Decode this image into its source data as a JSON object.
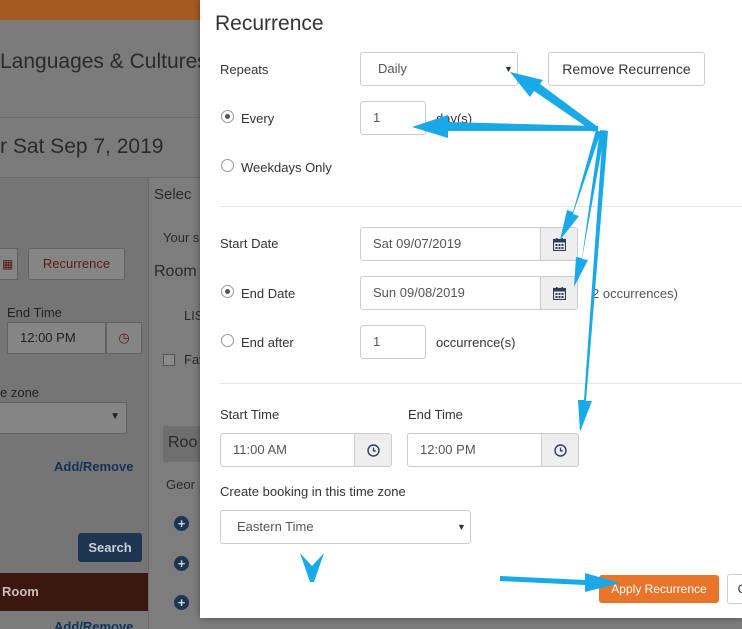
{
  "background": {
    "page_title": "Languages & Cultures",
    "date_heading": "r Sat Sep 7, 2019",
    "recurrence_button": "Recurrence",
    "end_time_label": "End Time",
    "end_time_value": "12:00 PM",
    "time_zone_label": "e zone",
    "add_remove_1": "Add/Remove",
    "search_button": "Search",
    "room_label": "Room",
    "add_remove_2": "Add/Remove",
    "select_text": "Selec",
    "your_text": "Your s",
    "room_heading": "Room",
    "lis_text": "LIS",
    "fav_text": "Fav",
    "roo_header": "Roo",
    "geo_text": "Geor",
    "plus_glyph": "+"
  },
  "modal": {
    "title": "Recurrence",
    "repeats": {
      "label": "Repeats",
      "value": "Daily",
      "remove_button": "Remove Recurrence"
    },
    "every": {
      "label": "Every",
      "value": "1",
      "unit": "day(s)",
      "checked": true
    },
    "weekdays_only": {
      "label": "Weekdays Only",
      "checked": false
    },
    "start_date": {
      "label": "Start Date",
      "value": "Sat 09/07/2019"
    },
    "end_date": {
      "label": "End Date",
      "value": "Sun 09/08/2019",
      "occurrences_note": "2 occurrences)",
      "checked": true
    },
    "end_after": {
      "label": "End after",
      "value": "1",
      "unit": "occurrence(s)",
      "checked": false
    },
    "start_time": {
      "label": "Start Time",
      "value": "11:00 AM"
    },
    "end_time": {
      "label": "End Time",
      "value": "12:00 PM"
    },
    "time_zone": {
      "label": "Create booking in this time zone",
      "value": "Eastern Time"
    },
    "apply_button": "Apply Recurrence",
    "cancel_button_partial": "C"
  },
  "colors": {
    "accent_orange": "#e8752a",
    "annotation_cyan": "#1aa9e8",
    "navy": "#1d3550",
    "maroon": "#5b1c14"
  },
  "icons": {
    "calendar": "calendar-icon",
    "clock": "clock-icon",
    "caret": "caret-down-icon"
  }
}
